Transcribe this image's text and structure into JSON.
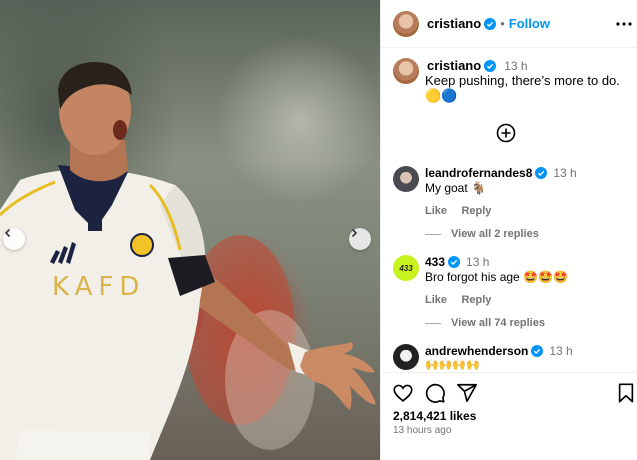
{
  "post": {
    "author": "cristiano",
    "follow_label": "Follow",
    "caption": "Keep pushing, there’s more to do. 🟡🔵",
    "caption_time": "13 h"
  },
  "photo": {
    "shirt_text": "KAFD"
  },
  "comments": [
    {
      "user": "leandrofernandes8",
      "time": "13 h",
      "text": "My goat 🐐",
      "like": "Like",
      "reply": "Reply",
      "view_replies": "View all 2 replies"
    },
    {
      "user": "433",
      "time": "13 h",
      "text": "Bro forgot his age 🤩🤩🤩",
      "like": "Like",
      "reply": "Reply",
      "view_replies": "View all 74 replies"
    },
    {
      "user": "andrewhenderson",
      "time": "13 h",
      "text": "🙌🙌🙌🙌"
    }
  ],
  "stats": {
    "likes": "2,814,421 likes",
    "posted": "13 hours ago"
  },
  "icons": [
    "heart-icon",
    "comment-icon",
    "share-icon",
    "bookmark-icon",
    "more-icon",
    "add-comment-icon",
    "chevron-left-icon",
    "chevron-right-icon",
    "verified-icon"
  ],
  "colors": {
    "accent": "#0095f6",
    "verified": "#0095f6",
    "muted": "#737373"
  }
}
